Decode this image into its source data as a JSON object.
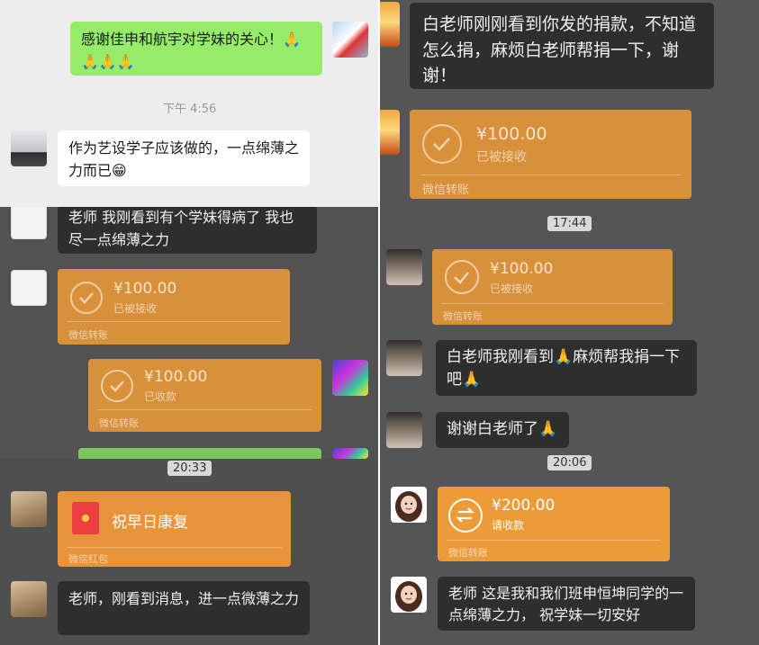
{
  "panel_top_left": {
    "msg_sent": "感谢佳申和航宇对学妹的关心！🙏🙏🙏🙏",
    "timestamp": "下午 4:56",
    "msg_received": "作为艺设学子应该做的，一点绵薄之力而已😁"
  },
  "panel_mid_left": {
    "msg_1": "老师 我刚看到有个学妹得病了 我也尽一点绵薄之力",
    "transfer_1": {
      "amount": "¥100.00",
      "status": "已被接收",
      "footer": "微信转账"
    },
    "transfer_2": {
      "amount": "¥100.00",
      "status": "已收款",
      "footer": "微信转账"
    }
  },
  "panel_bottom_left": {
    "timestamp": "20:33",
    "red_packet": {
      "text": "祝早日康复",
      "footer": "微信红包"
    },
    "msg": "老师，刚看到消息，进一点微薄之力"
  },
  "panel_right": {
    "msg_1": "白老师刚刚看到你发的捐款，不知道怎么捐，麻烦白老师帮捐一下，谢谢！",
    "transfer_1": {
      "amount": "¥100.00",
      "status": "已被接收",
      "footer": "微信转账"
    },
    "timestamp_1": "17:44",
    "transfer_2": {
      "amount": "¥100.00",
      "status": "已被接收",
      "footer": "微信转账"
    },
    "msg_2": "白老师我刚看到🙏麻烦帮我捐一下吧🙏",
    "msg_3": "谢谢白老师了🙏",
    "timestamp_2": "20:06",
    "transfer_3": {
      "amount": "¥200.00",
      "status": "请收款",
      "footer": "微信转账"
    },
    "msg_4": "老师 这是我和我们班申恒坤同学的一点绵薄之力， 祝学妹一切安好"
  },
  "colors": {
    "transfer_orange": "#e4963a",
    "sent_green": "#95ec69",
    "dark_bubble": "#2e2e2e",
    "red_packet": "#e8413f"
  }
}
